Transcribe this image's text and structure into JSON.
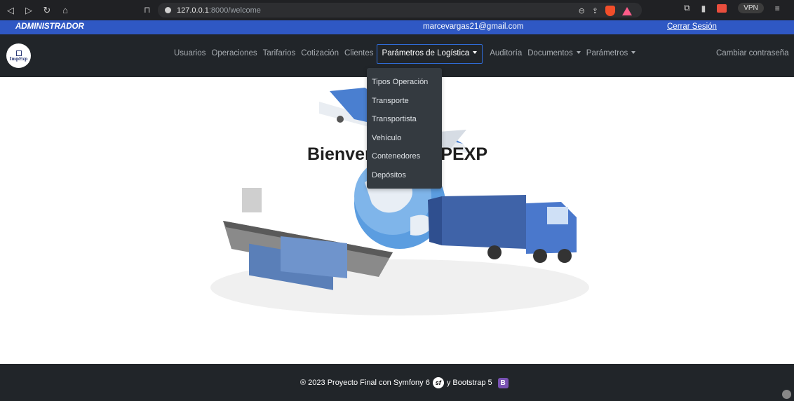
{
  "browser": {
    "url_host": "127.0.0.1",
    "url_path": ":8000/welcome",
    "vpn_label": "VPN"
  },
  "adminbar": {
    "role": "ADMINISTRADOR",
    "email": "marcevargas21@gmail.com",
    "logout": "Cerrar Sesión"
  },
  "navbar": {
    "logo_text": "ImpExp",
    "items": [
      {
        "label": "Usuarios"
      },
      {
        "label": "Operaciones"
      },
      {
        "label": "Tarifarios"
      },
      {
        "label": "Cotización"
      },
      {
        "label": "Clientes"
      },
      {
        "label": "Parámetros de Logística"
      },
      {
        "label": "Auditoría"
      },
      {
        "label": "Documentos"
      },
      {
        "label": "Parámetros"
      }
    ],
    "change_password": "Cambiar contraseña"
  },
  "dropdown": {
    "items": [
      "Tipos Operación",
      "Transporte",
      "Transportista",
      "Vehículo",
      "Contenedores",
      "Depósitos"
    ]
  },
  "hero": {
    "title": "Bienvenido a IMPEXP"
  },
  "footer": {
    "text_before": "® 2023 Proyecto Final con Symfony 6",
    "text_after": "y Bootstrap 5"
  },
  "colors": {
    "admin_bar": "#2f58c4",
    "navbar": "#212529",
    "dropdown": "#343a40",
    "active_border": "#2f6bd6"
  }
}
